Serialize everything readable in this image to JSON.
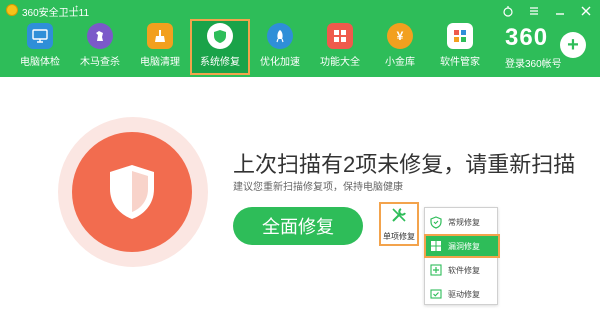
{
  "window": {
    "title": "360安全卫士11"
  },
  "nav": {
    "items": [
      {
        "label": "电脑体检"
      },
      {
        "label": "木马查杀"
      },
      {
        "label": "电脑清理"
      },
      {
        "label": "系统修复"
      },
      {
        "label": "优化加速"
      },
      {
        "label": "功能大全"
      },
      {
        "label": "小金库"
      },
      {
        "label": "软件管家"
      }
    ],
    "active_index": 3
  },
  "account": {
    "logo_text": "360",
    "login_label": "登录360帐号"
  },
  "main": {
    "title": "上次扫描有2项未修复，请重新扫描",
    "subtitle": "建议您重新扫描修复项，保持电脑健康",
    "repair_button": "全面修复",
    "single_repair_label": "单项修复"
  },
  "dropdown": {
    "items": [
      {
        "label": "常规修复"
      },
      {
        "label": "漏洞修复"
      },
      {
        "label": "软件修复"
      },
      {
        "label": "驱动修复"
      }
    ],
    "selected_index": 1
  },
  "colors": {
    "brand_green": "#2ebd59",
    "highlight_orange": "#f3a34c",
    "alert_red": "#f26c4f"
  }
}
